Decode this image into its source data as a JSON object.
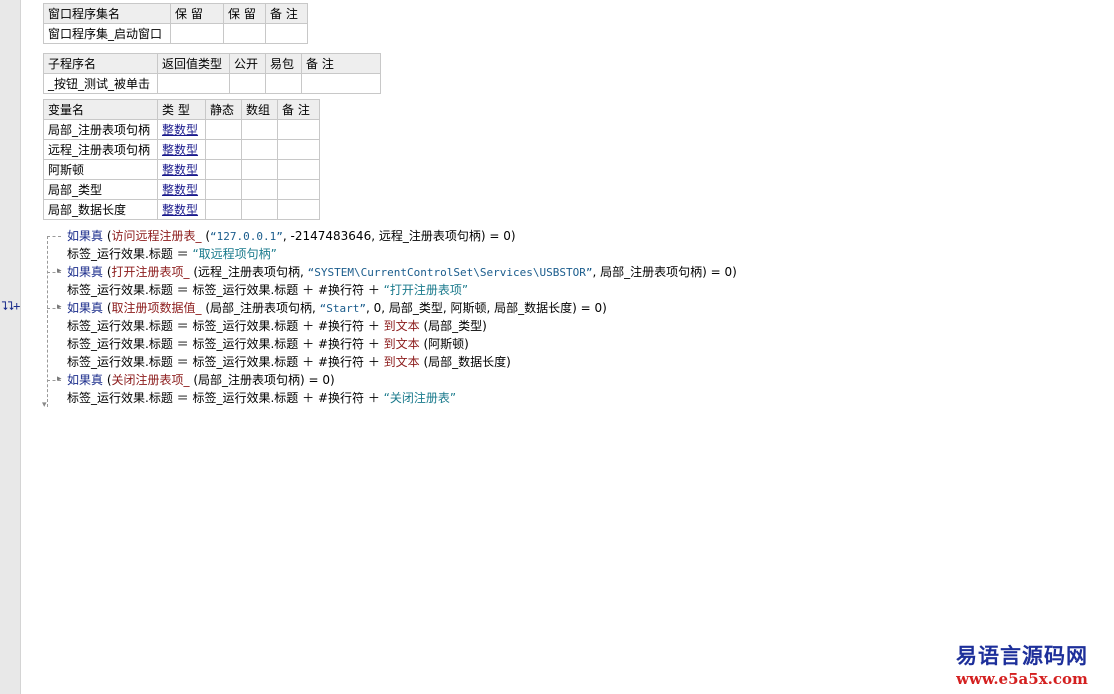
{
  "assembly_table": {
    "headers": [
      "窗口程序集名",
      "保 留",
      "保 留",
      "备 注"
    ],
    "row": [
      "窗口程序集_启动窗口",
      "",
      "",
      ""
    ]
  },
  "sub_table": {
    "headers": [
      "子程序名",
      "返回值类型",
      "公开",
      "易包",
      "备 注"
    ],
    "row": [
      "_按钮_测试_被单击",
      "",
      "",
      "",
      ""
    ]
  },
  "var_table": {
    "headers": [
      "变量名",
      "类 型",
      "静态",
      "数组",
      "备 注"
    ],
    "rows": [
      {
        "name": "局部_注册表项句柄",
        "type": "整数型"
      },
      {
        "name": "远程_注册表项句柄",
        "type": "整数型"
      },
      {
        "name": "阿斯顿",
        "type": "整数型"
      },
      {
        "name": "局部_类型",
        "type": "整数型"
      },
      {
        "name": "局部_数据长度",
        "type": "整数型"
      }
    ]
  },
  "gutter_mark": "⮧⮧+",
  "code": {
    "kw_if": "如果真",
    "label_prop": "标签_运行效果.标题",
    "newline": "#换行符",
    "to_text": "到文本",
    "l1_fn": "访问远程注册表_",
    "l1_str": "“127.0.0.1”",
    "l1_rest": ", -2147483646, 远程_注册表项句柄) = 0)",
    "l2_str": "“取远程项句柄”",
    "l3_fn": "打开注册表项_",
    "l3_arg1": "(远程_注册表项句柄, ",
    "l3_str": "“SYSTEM\\CurrentControlSet\\Services\\USBSTOR”",
    "l3_rest": ", 局部_注册表项句柄) = 0)",
    "l4_str": "“打开注册表项”",
    "l5_fn": "取注册项数据值_",
    "l5_arg1": "(局部_注册表项句柄, ",
    "l5_str": "“Start”",
    "l5_rest": ", 0, 局部_类型, 阿斯顿, 局部_数据长度) = 0)",
    "l6_arg": "(局部_类型)",
    "l7_arg": "(阿斯顿)",
    "l8_arg": "(局部_数据长度)",
    "l9_fn": "关闭注册表项_",
    "l9_rest": "(局部_注册表项句柄) = 0)",
    "l10_str": "“关闭注册表”"
  },
  "watermark": {
    "title": "易语言源码网",
    "url": "www.e5a5x.com"
  },
  "colors": {
    "keyword": "#1c2e8c",
    "function": "#8b1a1a",
    "string": "#1a5c8c",
    "type_link": "#1a1a8c",
    "watermark_title": "#1d2f9a",
    "watermark_url": "#d42020"
  }
}
